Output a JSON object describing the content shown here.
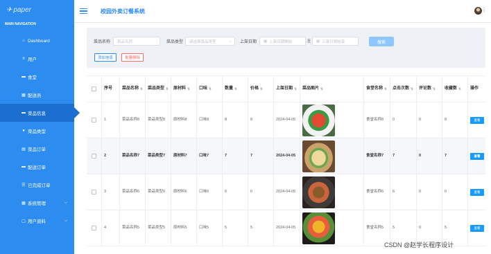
{
  "sidebar": {
    "logo": "paper",
    "section_title": "MAIN NAVIGATION",
    "items": [
      {
        "label": "Dashboard",
        "icon": "home-icon",
        "glyph": "⌂"
      },
      {
        "label": "用户",
        "icon": "list-icon",
        "glyph": "≡"
      },
      {
        "label": "食堂",
        "icon": "folder-icon",
        "glyph": "▬"
      },
      {
        "label": "配送员",
        "icon": "grid-icon",
        "glyph": "▦"
      },
      {
        "label": "菜品信息",
        "icon": "message-icon",
        "glyph": "▬",
        "active": true
      },
      {
        "label": "菜品类型",
        "icon": "user-icon",
        "glyph": "●"
      },
      {
        "label": "菜品订单",
        "icon": "document-icon",
        "glyph": "▤"
      },
      {
        "label": "配送订单",
        "icon": "ticket-icon",
        "glyph": "▬"
      },
      {
        "label": "已完成订单",
        "icon": "sliders-icon",
        "glyph": "☰"
      },
      {
        "label": "系统管理",
        "icon": "grid-icon",
        "glyph": "▦",
        "chevron": "⌵"
      },
      {
        "label": "用户资料",
        "icon": "window-icon",
        "glyph": "▢",
        "chevron": "⌵"
      }
    ]
  },
  "header": {
    "title": "校园外卖订餐系统",
    "more": "⋮"
  },
  "search": {
    "name_label": "菜品名称",
    "name_placeholder": "菜品名称",
    "type_label": "菜品类型",
    "type_placeholder": "请选择菜品类型",
    "date_label": "上架日期",
    "date_start_placeholder": "上架日期開始",
    "date_sep": "至",
    "date_end_placeholder": "上架日期結束",
    "search_button": "搜索",
    "add_button": "添加信息",
    "delete_button": "批量删除"
  },
  "table": {
    "headers": [
      "序号",
      "菜品名称",
      "菜品类型",
      "原材料",
      "口味",
      "数量",
      "价格",
      "上架日期",
      "菜品图片",
      "食堂名称",
      "点击次数",
      "评论数",
      "收藏数",
      "操作"
    ],
    "rows": [
      {
        "index": "1",
        "name": "菜品名称8",
        "type": "菜品类型8",
        "material": "原材料8",
        "taste": "口味8",
        "qty": "8",
        "price": "8",
        "date": "2024-04-05",
        "canteen": "食堂名称8",
        "clicks": "0",
        "comments": "0",
        "favorites": "8",
        "op": "查看"
      },
      {
        "index": "2",
        "name": "菜品名称7",
        "type": "菜品类型7",
        "material": "原材料7",
        "taste": "口味7",
        "qty": "7",
        "price": "7",
        "date": "2024-04-05",
        "canteen": "食堂名称7",
        "clicks": "7",
        "comments": "0",
        "favorites": "7",
        "op": "查看"
      },
      {
        "index": "3",
        "name": "菜品名称6",
        "type": "菜品类型6",
        "material": "原材料6",
        "taste": "口味6",
        "qty": "6",
        "price": "6",
        "date": "2024-04-05",
        "canteen": "食堂名称6",
        "clicks": "6",
        "comments": "0",
        "favorites": "6",
        "op": "查看"
      },
      {
        "index": "4",
        "name": "菜品名称5",
        "type": "菜品类型5",
        "material": "原材料5",
        "taste": "口味5",
        "qty": "5",
        "price": "5",
        "date": "2024-04-05",
        "canteen": "食堂名称5",
        "clicks": "5",
        "comments": "0",
        "favorites": "5",
        "op": "查看"
      }
    ]
  },
  "watermark": "CSDN @赵学长程序设计",
  "colors": {
    "sidebar": "#2d8cf0",
    "active": "#1a6fd0",
    "accent": "#2d8cf0",
    "danger": "#f56c6c"
  }
}
